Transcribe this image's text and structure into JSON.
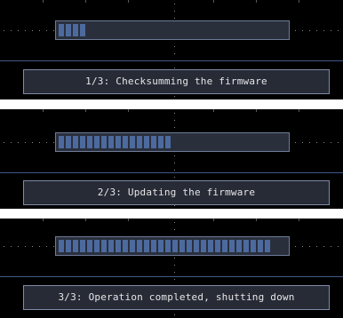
{
  "colors": {
    "background": "#000000",
    "bar_fill": "#4c6a9e",
    "bar_track": "#2a2f3c",
    "bar_border": "#6e7c99",
    "message_box": "#272b36",
    "message_border": "#7f8aa6",
    "message_text": "#e6e6e6",
    "grid_dots": "#8a8a8a"
  },
  "steps": [
    {
      "message": "1/3: Checksumming the firmware",
      "progress_segments": 4,
      "total_segments": 30
    },
    {
      "message": "2/3: Updating the firmware",
      "progress_segments": 16,
      "total_segments": 30
    },
    {
      "message": "3/3: Operation completed, shutting down",
      "progress_segments": 30,
      "total_segments": 30
    }
  ]
}
